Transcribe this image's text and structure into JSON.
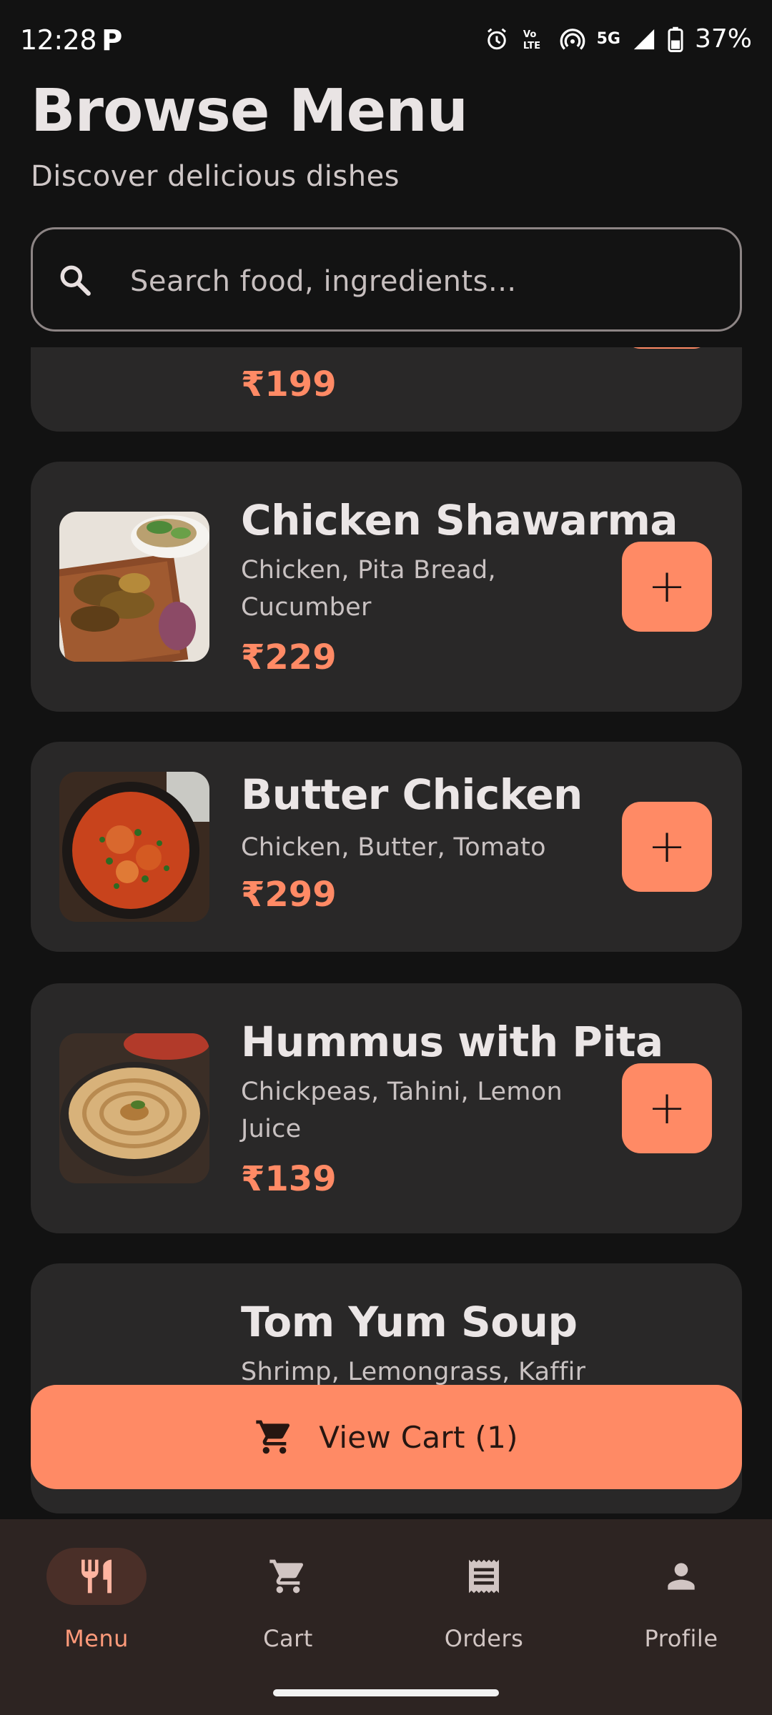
{
  "status_bar": {
    "time": "12:28",
    "app_icon": "P",
    "network": "5G",
    "volte": "VoLTE",
    "battery": "37%"
  },
  "header": {
    "title": "Browse Menu",
    "subtitle": "Discover delicious dishes"
  },
  "search": {
    "placeholder": "Search food, ingredients..."
  },
  "menu_items": [
    {
      "name": "",
      "description": "",
      "price": "₹199"
    },
    {
      "name": "Chicken Shawarma",
      "description": "Chicken, Pita Bread, Cucumber",
      "price": "₹229"
    },
    {
      "name": "Butter Chicken",
      "description": "Chicken, Butter, Tomato",
      "price": "₹299"
    },
    {
      "name": "Hummus with Pita",
      "description": "Chickpeas, Tahini, Lemon Juice",
      "price": "₹139"
    },
    {
      "name": "Tom Yum Soup",
      "description": "Shrimp, Lemongrass, Kaffir",
      "price": ""
    }
  ],
  "add_button_symbol": "+",
  "view_cart": {
    "label": "View Cart (1)"
  },
  "bottom_nav": [
    {
      "label": "Menu",
      "icon": "restaurant-icon",
      "active": true
    },
    {
      "label": "Cart",
      "icon": "cart-icon",
      "active": false
    },
    {
      "label": "Orders",
      "icon": "receipt-icon",
      "active": false
    },
    {
      "label": "Profile",
      "icon": "person-icon",
      "active": false
    }
  ],
  "colors": {
    "background": "#121212",
    "card": "#292828",
    "accent": "#ff8a65",
    "nav_background": "#2d2422"
  }
}
